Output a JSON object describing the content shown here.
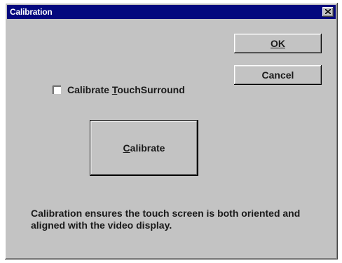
{
  "window": {
    "title": "Calibration"
  },
  "buttons": {
    "ok_label": "OK",
    "cancel_label": "Cancel",
    "calibrate_label_accel": "C",
    "calibrate_label_rest": "alibrate"
  },
  "checkbox": {
    "label_before": "Calibrate ",
    "label_accel": "T",
    "label_after": "ouchSurround",
    "checked": false
  },
  "description": "Calibration ensures the touch screen is both oriented and aligned with the video display.",
  "icons": {
    "close": "close-icon"
  },
  "colors": {
    "titlebar": "#04087e",
    "face": "#c3c3c3"
  }
}
